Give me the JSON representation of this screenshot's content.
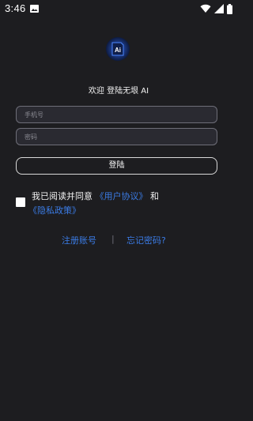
{
  "status_bar": {
    "time": "3:46",
    "icons": [
      "photo-icon",
      "wifi-icon",
      "signal-icon",
      "battery-icon"
    ]
  },
  "app": {
    "logo_icon": "ai-logo-icon",
    "logo_text": "Ai",
    "welcome": "欢迎 登陆无垠 AI"
  },
  "form": {
    "phone_placeholder": "手机号",
    "phone_value": "",
    "password_placeholder": "密码",
    "password_value": "",
    "login_label": "登陆"
  },
  "agreement": {
    "checked": false,
    "prefix": "我已阅读并同意",
    "user_agreement": "《用户协议》",
    "conjunction": "和",
    "privacy_policy": "《隐私政策》"
  },
  "links": {
    "register": "注册账号",
    "separator": "|",
    "forgot_password": "忘记密码?"
  },
  "colors": {
    "background": "#1d1d20",
    "accent": "#3b7ce6",
    "field_border": "#6e6e78"
  }
}
